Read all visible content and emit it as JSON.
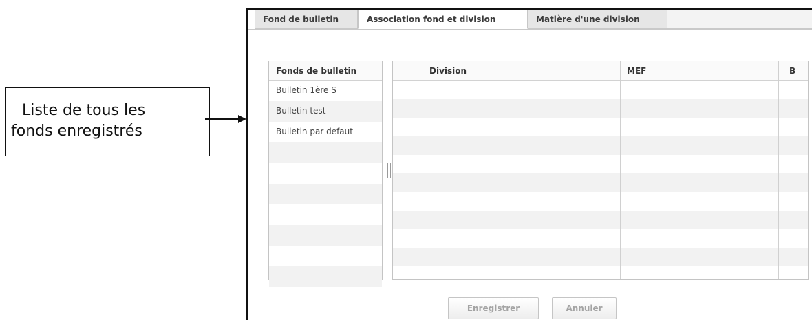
{
  "annotation": {
    "line1": "Liste de tous les",
    "line2": "fonds enregistrés"
  },
  "tabs": [
    {
      "label": "Fond de bulletin",
      "active": false
    },
    {
      "label": "Association fond et division",
      "active": true
    },
    {
      "label": "Matière d'une division",
      "active": false
    }
  ],
  "fonds_list": {
    "header": "Fonds de bulletin",
    "items": [
      "Bulletin 1ère S",
      "Bulletin test",
      "Bulletin par defaut"
    ]
  },
  "grid": {
    "columns": [
      "",
      "Division",
      "MEF",
      "B"
    ]
  },
  "buttons": {
    "save": "Enregistrer",
    "cancel": "Annuler"
  },
  "colors": {
    "tab_inactive": "#e6e6e6",
    "row_alt": "#f2f2f2",
    "border": "#c4c4c4",
    "disabled_text": "#a4a4a4"
  }
}
